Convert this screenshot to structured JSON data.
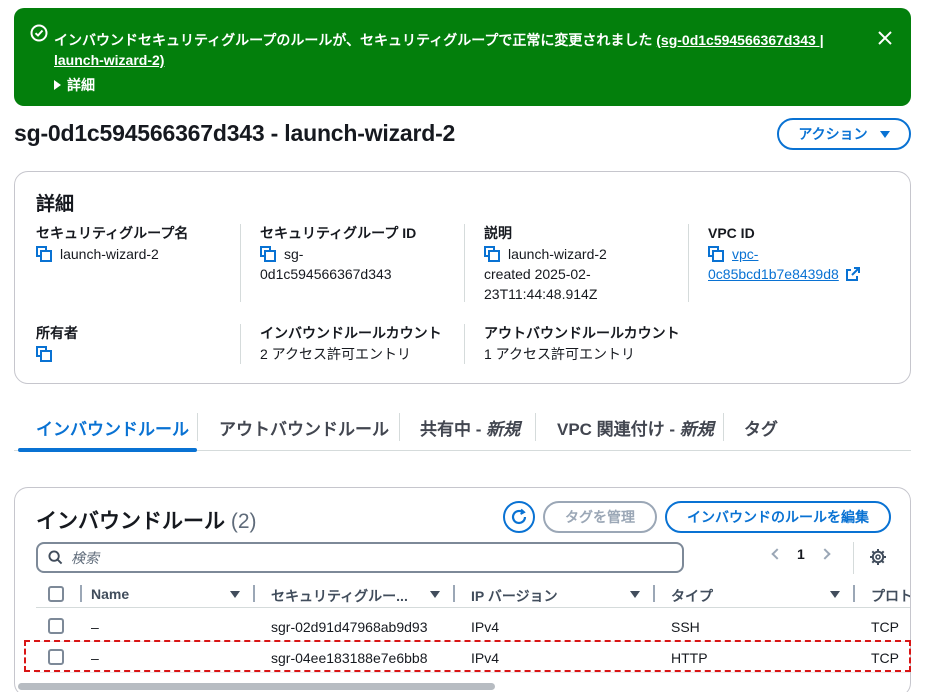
{
  "flash": {
    "message": "インバウンドセキュリティグループのルールが、セキュリティグループで正常に変更されました",
    "link": "(sg-0d1c594566367d343 | launch-wizard-2)",
    "details_label": "詳細",
    "color": "#037f0c"
  },
  "page": {
    "title": "sg-0d1c594566367d343 - launch-wizard-2",
    "actions_label": "アクション"
  },
  "details": {
    "heading": "詳細",
    "sg_name_label": "セキュリティグループ名",
    "sg_name": "launch-wizard-2",
    "sg_id_label": "セキュリティグループ ID",
    "sg_id_line1": "sg-",
    "sg_id_line2": "0d1c594566367d343",
    "desc_label": "説明",
    "desc_line1": "launch-wizard-2",
    "desc_line2": "created 2025-02-",
    "desc_line3": "23T11:44:48.914Z",
    "vpc_label": "VPC ID",
    "vpc_line1": "vpc-",
    "vpc_line2": "0c85bcd1b7e8439d8",
    "owner_label": "所有者",
    "owner_value": "",
    "inbound_count_label": "インバウンドルールカウント",
    "inbound_count": "2 アクセス許可エントリ",
    "outbound_count_label": "アウトバウンドルールカウント",
    "outbound_count": "1 アクセス許可エントリ"
  },
  "tabs": [
    {
      "label": "インバウンドルール",
      "suffix": ""
    },
    {
      "label": "アウトバウンドルール",
      "suffix": ""
    },
    {
      "label": "共有中 - ",
      "suffix": "新規"
    },
    {
      "label": "VPC 関連付け - ",
      "suffix": "新規"
    },
    {
      "label": "タグ",
      "suffix": ""
    }
  ],
  "rules": {
    "heading": "インバウンドルール",
    "count": "(2)",
    "manage_tags_label": "タグを管理",
    "edit_label": "インバウンドのルールを編集",
    "search_placeholder": "検索",
    "page": "1",
    "columns": [
      "Name",
      "セキュリティグルー...",
      "IP バージョン",
      "タイプ",
      "プロト"
    ],
    "rows": [
      {
        "name": "–",
        "rule_id": "sgr-02d91d47968ab9d93",
        "ip_version": "IPv4",
        "type": "SSH",
        "protocol": "TCP"
      },
      {
        "name": "–",
        "rule_id": "sgr-04ee183188e7e6bb8",
        "ip_version": "IPv4",
        "type": "HTTP",
        "protocol": "TCP"
      }
    ]
  },
  "colors": {
    "accent": "#0972d3",
    "highlight": "#d91515"
  }
}
